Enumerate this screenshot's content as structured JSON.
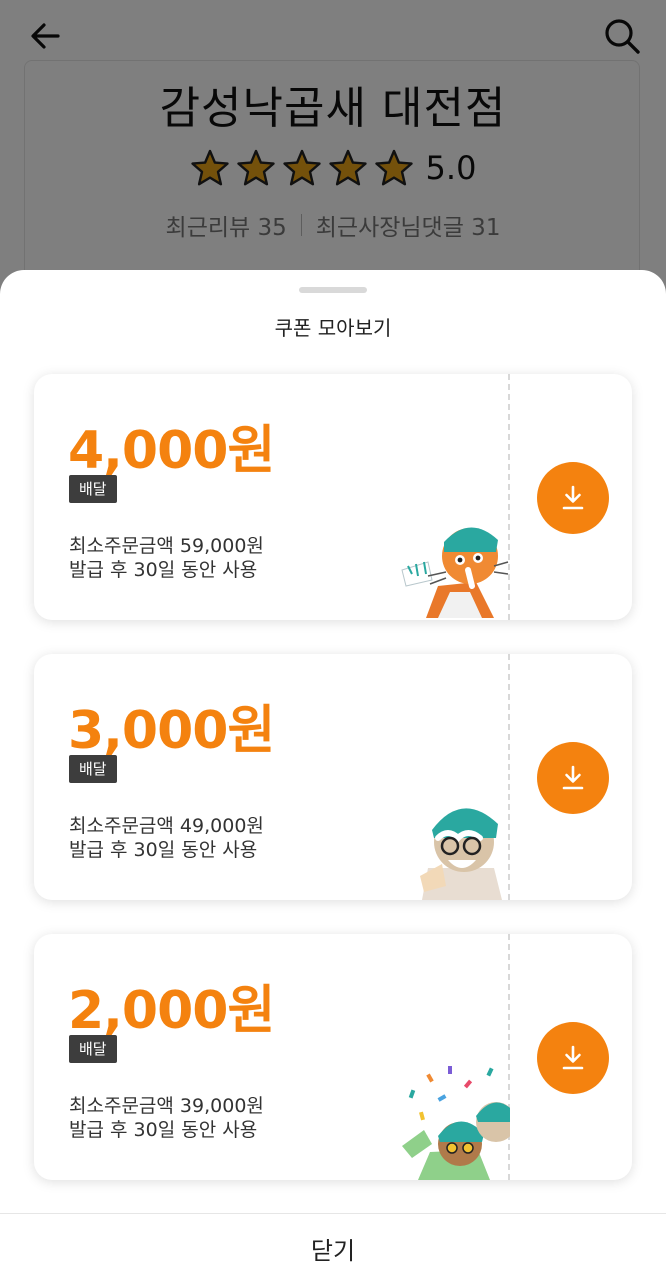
{
  "store": {
    "name": "감성낙곱새 대전점",
    "rating": "5.0",
    "rating_stars": 5,
    "recent_reviews": "최근리뷰 35",
    "owner_replies": "최근사장님댓글 31"
  },
  "icons": {
    "back": "arrow-left-icon",
    "search": "search-icon",
    "star": "star-icon",
    "download": "download-icon"
  },
  "colors": {
    "accent": "#f4820f",
    "star": "#e9a316",
    "tag_bg": "#3d3d3d"
  },
  "sheet": {
    "title": "쿠폰 모아보기",
    "close_label": "닫기"
  },
  "coupons": [
    {
      "amount": "4,000원",
      "tag": "배달",
      "min_order": "최소주문금액 59,000원",
      "period": "발급 후 30일 동안 사용"
    },
    {
      "amount": "3,000원",
      "tag": "배달",
      "min_order": "최소주문금액 49,000원",
      "period": "발급 후 30일 동안 사용"
    },
    {
      "amount": "2,000원",
      "tag": "배달",
      "min_order": "최소주문금액 39,000원",
      "period": "발급 후 30일 동안 사용"
    }
  ]
}
